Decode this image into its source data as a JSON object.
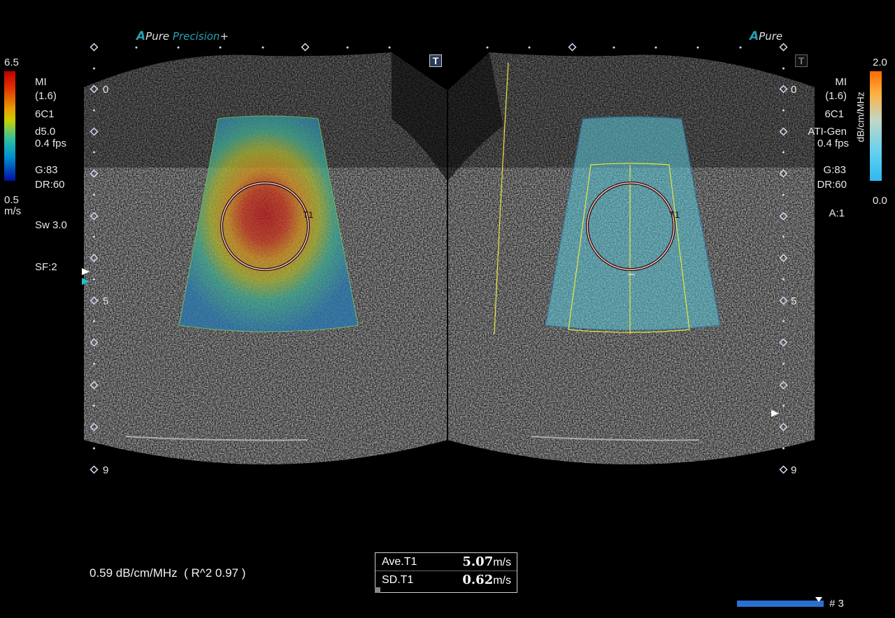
{
  "left_panel": {
    "logo_a": "A",
    "logo_pure": "Pure",
    "logo_precision": "Precision",
    "logo_plus": "+",
    "scale_max": "6.5",
    "scale_min": "0.5",
    "scale_unit": "m/s",
    "info": [
      "MI",
      "(1.6)",
      "6C1",
      "d5.0",
      "0.4 fps",
      "G:83",
      "DR:60"
    ],
    "sweep": "Sw 3.0",
    "sf": "SF:2",
    "depth_marks": [
      "0",
      "5",
      "9"
    ],
    "roi_label": "T1",
    "t_button": "T"
  },
  "right_panel": {
    "logo_a": "A",
    "logo_pure": "Pure",
    "scale_max": "2.0",
    "scale_min": "0.0",
    "scale_unit": "dB/cm/MHz",
    "info": [
      "MI",
      "(1.6)",
      "6C1",
      "ATI-Gen",
      "0.4 fps",
      "G:83",
      "DR:60"
    ],
    "a_label": "A:1",
    "depth_marks": [
      "0",
      "5",
      "9"
    ],
    "roi_label": "T1",
    "t_button": "T"
  },
  "attenuation_result": "0.59 dB/cm/MHz  ( R^2 0.97 )",
  "measurements": [
    {
      "label": "Ave.T1",
      "value": "5.07",
      "unit": "m/s"
    },
    {
      "label": "SD.T1",
      "value": "0.62",
      "unit": "m/s"
    }
  ],
  "cine": {
    "label": "# 3",
    "position": 0.94
  }
}
